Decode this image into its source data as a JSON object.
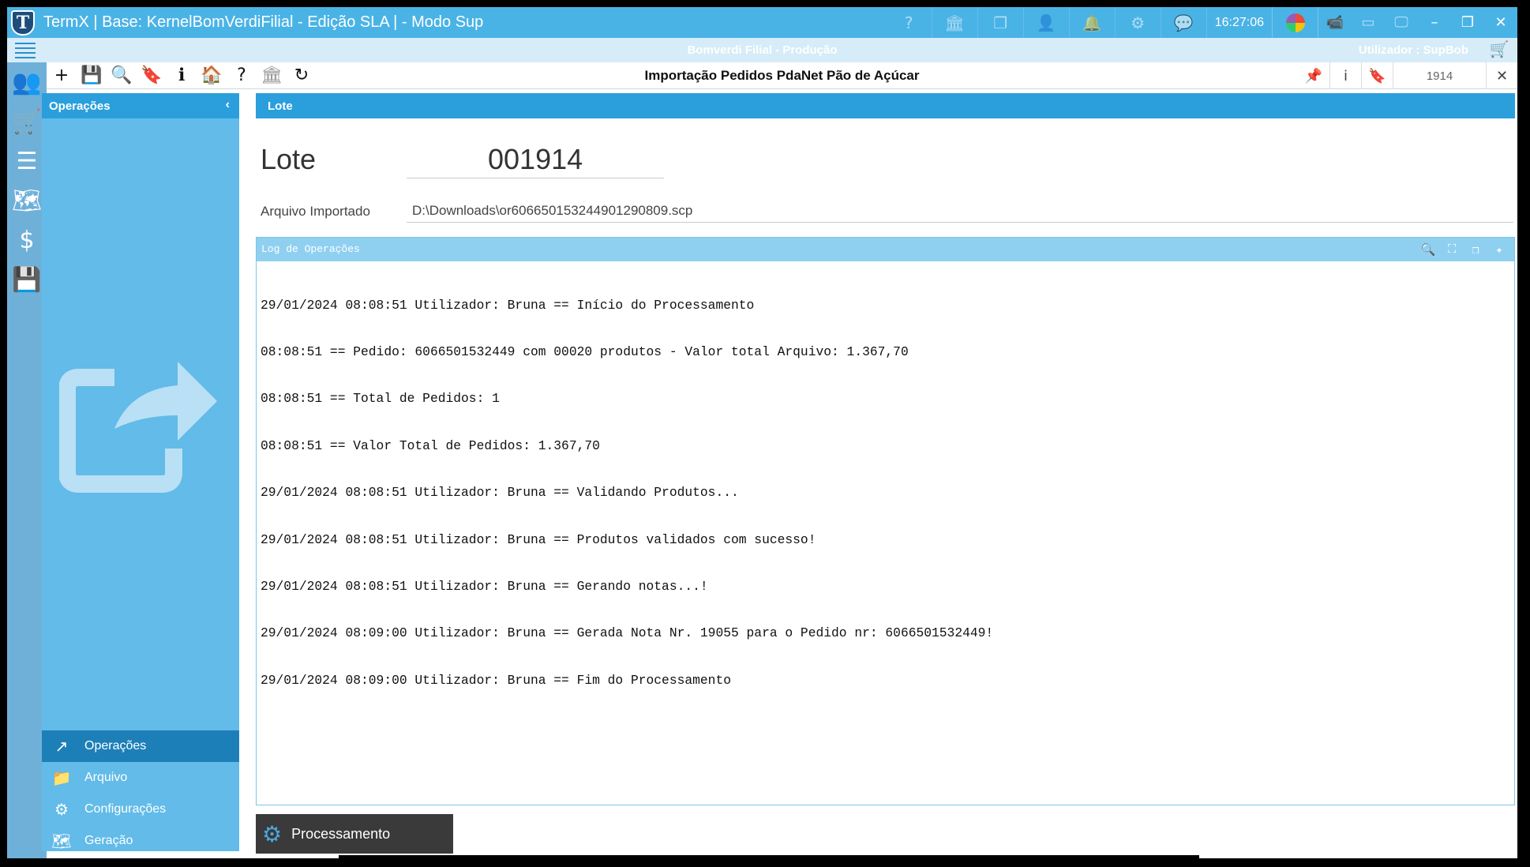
{
  "window": {
    "title": "TermX | Base: KernelBomVerdiFilial - Edição SLA | - Modo Sup",
    "clock": "16:27:06",
    "logo_letter": "T"
  },
  "subheader": {
    "environment": "Bomverdi Filial - Produção",
    "user": "Utilizador : SupBob"
  },
  "toolbar": {
    "title": "Importação Pedidos PdaNet Pão de Açúcar",
    "record_number": "1914"
  },
  "operations": {
    "header": "Operações",
    "menu": [
      {
        "label": "Operações",
        "active": true
      },
      {
        "label": "Arquivo",
        "active": false
      },
      {
        "label": "Configurações",
        "active": false
      },
      {
        "label": "Geração",
        "active": false
      }
    ]
  },
  "lote": {
    "section_header": "Lote",
    "label": "Lote",
    "value": "001914",
    "arquivo_label": "Arquivo Importado",
    "arquivo_value": "D:\\Downloads\\or6066501532449012908​09.scp"
  },
  "log": {
    "header": "Log de Operações",
    "lines": [
      "29/01/2024 08:08:51 Utilizador: Bruna == Início do Processamento",
      "08:08:51 == Pedido: 6066501532449 com 00020 produtos - Valor total Arquivo: 1.367,70",
      "08:08:51 == Total de Pedidos: 1",
      "08:08:51 == Valor Total de Pedidos: 1.367,70",
      "29/01/2024 08:08:51 Utilizador: Bruna == Validando Produtos...",
      "29/01/2024 08:08:51 Utilizador: Bruna == Produtos validados com sucesso!",
      "29/01/2024 08:08:51 Utilizador: Bruna == Gerando notas...!",
      "29/01/2024 08:09:00 Utilizador: Bruna == Gerada Nota Nr. 19055 para o Pedido nr: 6066501532449!",
      "29/01/2024 08:09:00 Utilizador: Bruna == Fim do Processamento"
    ]
  },
  "actions": {
    "process_label": "Processamento"
  },
  "colors": {
    "titlebar": "#4ab3e6",
    "panel": "#62bbe8",
    "header": "#2a9fdb",
    "active_item": "#1d7fb8"
  }
}
